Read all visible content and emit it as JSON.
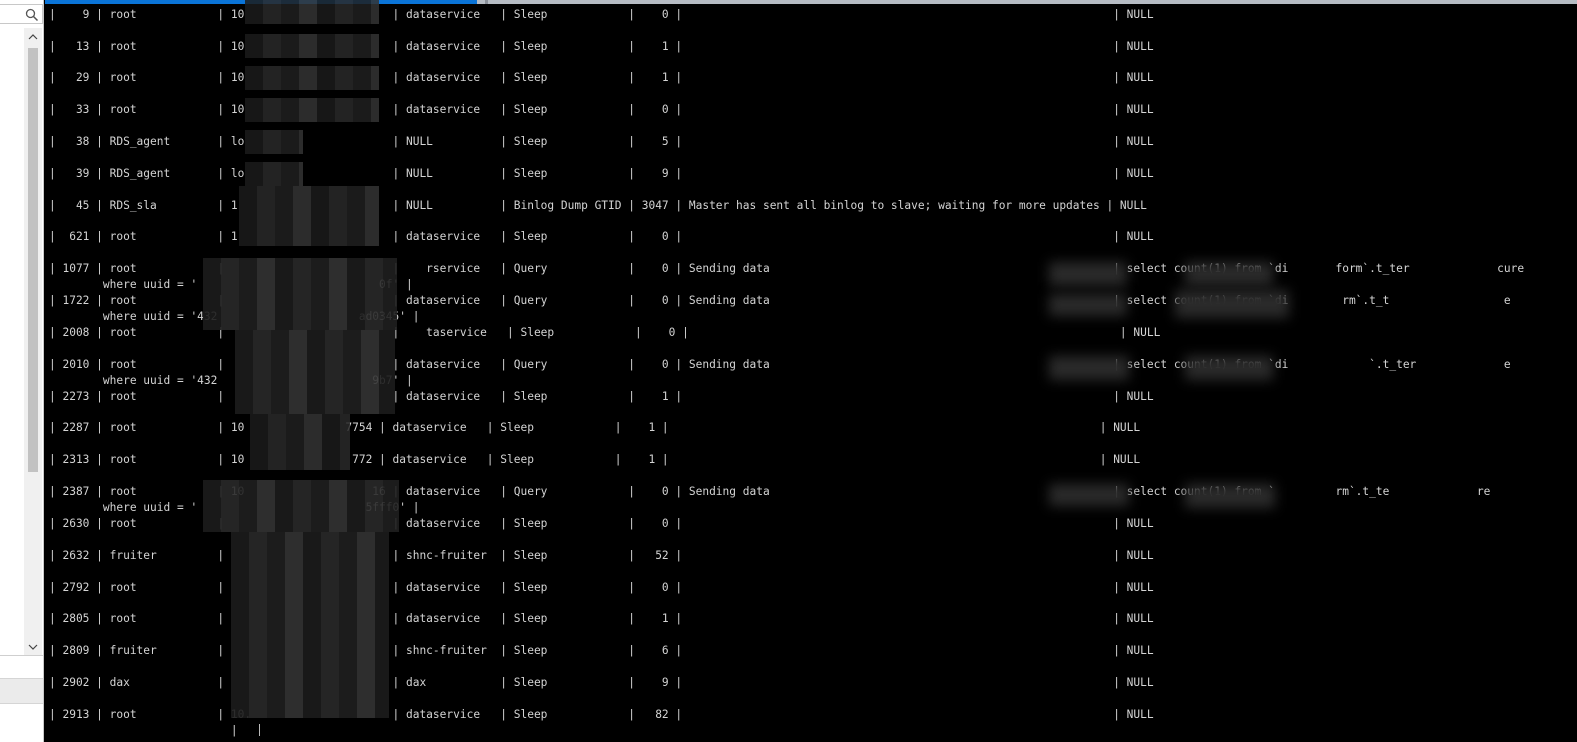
{
  "left_panel": {
    "search_icon": "search-icon",
    "scroll_up_icon": "chevron-up-icon",
    "scroll_down_icon": "chevron-down-icon"
  },
  "terminal": {
    "lines": [
      "|    9 | root            | 10                      | dataservice   | Sleep            |    0 |                                                                | NULL",
      "|   13 | root            | 10                      | dataservice   | Sleep            |    1 |                                                                | NULL",
      "|   29 | root            | 10                      | dataservice   | Sleep            |    1 |                                                                | NULL",
      "|   33 | root            | 10                      | dataservice   | Sleep            |    0 |                                                                | NULL",
      "|   38 | RDS_agent       | lo                      | NULL          | Sleep            |    5 |                                                                | NULL",
      "|   39 | RDS_agent       | lo                      | NULL          | Sleep            |    9 |                                                                | NULL",
      "|   45 | RDS_sla         | 1                       | NULL          | Binlog Dump GTID | 3047 | Master has sent all binlog to slave; waiting for more updates | NULL",
      "|  621 | root            | 1                       | dataservice   | Sleep            |    0 |                                                                | NULL",
      "| 1077 | root            |                         |    rservice   | Query            |    0 | Sending data                                                   | select count(1) from `di       form`.t_ter             cure",
      "        where uuid = '                           0f' |",
      "| 1722 | root            |                         | dataservice   | Query            |    0 | Sending data                                                   | select count(1) from `di        rm`.t_t                 e",
      "        where uuid = '432                     ad0345' |",
      "| 2008 | root            |                         |    taservice   | Sleep            |    0 |                                                                | NULL",
      "| 2010 | root            |                         | dataservice   | Query            |    0 | Sending data                                                   | select count(1) from `di            `.t_ter             e",
      "        where uuid = '432                       9b7' |",
      "| 2273 | root            |                         | dataservice   | Sleep            |    1 |                                                                | NULL",
      "| 2287 | root            | 10               7754 | dataservice   | Sleep            |    1 |                                                                | NULL",
      "| 2313 | root            | 10                772 | dataservice   | Sleep            |    1 |                                                                | NULL",
      "| 2387 | root            | 10                   16 | dataservice   | Query            |    0 | Sending data                                                   | select count(1) from `         rm`.t_te             re",
      "        where uuid = '                         5fff0' |",
      "| 2630 | root            |                         | dataservice   | Sleep            |    0 |                                                                | NULL",
      "| 2632 | fruiter         |                         | shnc-fruiter  | Sleep            |   52 |                                                                | NULL",
      "| 2792 | root            |                         | dataservice   | Sleep            |    0 |                                                                | NULL",
      "| 2805 | root            |                         | dataservice   | Sleep            |    1 |                                                                | NULL",
      "| 2809 | fruiter         |                         | shnc-fruiter  | Sleep            |    6 |                                                                | NULL",
      "| 2902 | dax             |                         | dax           | Sleep            |    9 |                                                                | NULL",
      "| 2913 | root            | 10.                     | dataservice   | Sleep            |   82 |                                                                | NULL",
      "                           |"
    ]
  }
}
